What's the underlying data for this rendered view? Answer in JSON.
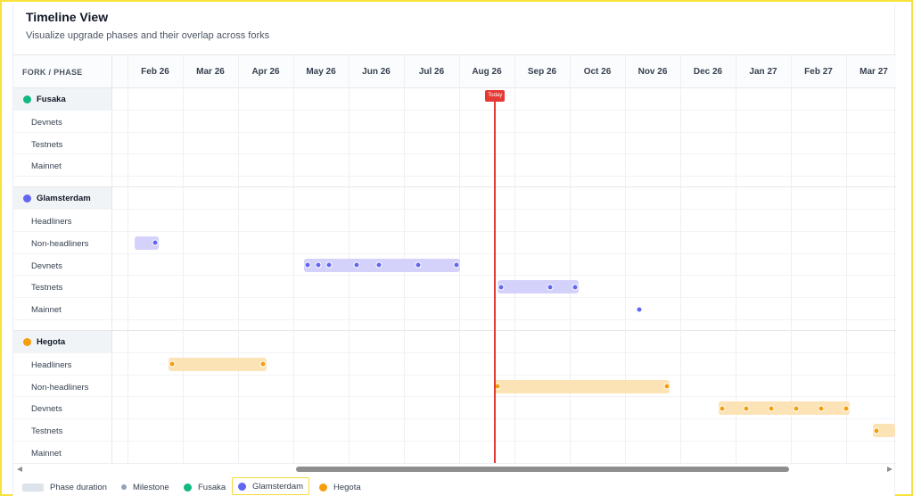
{
  "header": {
    "title": "Timeline View",
    "subtitle": "Visualize upgrade phases and their overlap across forks"
  },
  "grid": {
    "column_header": "FORK / PHASE",
    "months": [
      "Feb 26",
      "Mar 26",
      "Apr 26",
      "May 26",
      "Jun 26",
      "Jul 26",
      "Aug 26",
      "Sep 26",
      "Oct 26",
      "Nov 26",
      "Dec 26",
      "Jan 27",
      "Feb 27",
      "Mar 27"
    ],
    "today_label": "Today",
    "today_month_index": 6.15
  },
  "colors": {
    "fusaka": "#10b981",
    "glamsterdam": "#6366f1",
    "glamsterdam_bar": "#d4d2fa",
    "hegota": "#f59e0b",
    "hegota_bar": "#fbe3b6",
    "today": "#e53935",
    "milestone_legend": "#94a3b8",
    "phase_legend": "#dde3ea"
  },
  "forks": [
    {
      "name": "Fusaka",
      "color_key": "fusaka",
      "phases": [
        {
          "label": "Devnets"
        },
        {
          "label": "Testnets"
        },
        {
          "label": "Mainnet"
        }
      ]
    },
    {
      "name": "Glamsterdam",
      "color_key": "glamsterdam",
      "phases": [
        {
          "label": "Headliners"
        },
        {
          "label": "Non-headliners",
          "bar": [
            -0.3,
            0.0
          ],
          "milestones": [
            0.0
          ]
        },
        {
          "label": "Devnets",
          "bar": [
            2.75,
            5.45
          ],
          "milestones": [
            2.75,
            2.95,
            3.15,
            3.65,
            4.05,
            4.75,
            5.45
          ]
        },
        {
          "label": "Testnets",
          "bar": [
            6.25,
            7.6
          ],
          "milestones": [
            6.25,
            7.15,
            7.6
          ]
        },
        {
          "label": "Mainnet",
          "milestones": [
            8.75
          ]
        }
      ]
    },
    {
      "name": "Hegota",
      "color_key": "hegota",
      "phases": [
        {
          "label": "Headliners",
          "bar": [
            0.3,
            1.95
          ],
          "milestones": [
            0.3,
            1.95
          ]
        },
        {
          "label": "Non-headliners",
          "bar": [
            6.2,
            9.25
          ],
          "milestones": [
            6.2,
            9.25
          ]
        },
        {
          "label": "Devnets",
          "bar": [
            10.25,
            12.5
          ],
          "milestones": [
            10.25,
            10.7,
            11.15,
            11.6,
            12.05,
            12.5
          ]
        },
        {
          "label": "Testnets",
          "bar": [
            13.05,
            13.6
          ],
          "milestones": [
            13.05
          ]
        },
        {
          "label": "Mainnet"
        }
      ]
    }
  ],
  "legend": {
    "phase_duration": "Phase duration",
    "milestone": "Milestone",
    "fusaka": "Fusaka",
    "glamsterdam": "Glamsterdam",
    "hegota": "Hegota"
  }
}
